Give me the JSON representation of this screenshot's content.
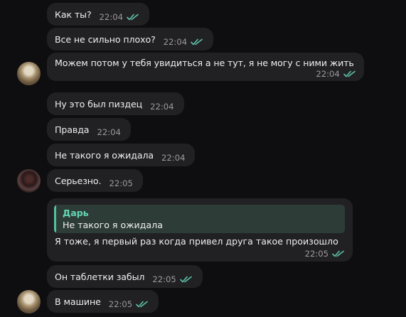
{
  "theme": {
    "bubble_color": "#212124",
    "background": "#0e0e10",
    "accent": "#4fc3a1",
    "read_check_color": "#5fc0a8"
  },
  "messages": [
    {
      "text": "Как ты?",
      "time": "22:04",
      "read": true,
      "avatar": false
    },
    {
      "text": "Все не сильно плохо?",
      "time": "22:04",
      "read": true,
      "avatar": false
    },
    {
      "text": "Можем потом у тебя увидиться а не тут, я не могу с ними жить",
      "time": "22:04",
      "read": true,
      "avatar": true
    },
    {
      "text": "Ну это был пиздец",
      "time": "22:04",
      "read": false,
      "avatar": false
    },
    {
      "text": "Правда",
      "time": "22:04",
      "read": false,
      "avatar": false
    },
    {
      "text": "Не такого я ожидала",
      "time": "22:04",
      "read": false,
      "avatar": false
    },
    {
      "text": "Серьезно.",
      "time": "22:05",
      "read": false,
      "avatar": true
    },
    {
      "reply_to": {
        "author": "Дарь",
        "text": "Не такого я ожидала"
      },
      "text": "Я тоже, я первый раз когда привел друга такое произошло",
      "time": "22:05",
      "read": true,
      "avatar": false
    },
    {
      "text": "Он таблетки забыл",
      "time": "22:05",
      "read": true,
      "avatar": false
    },
    {
      "text": "В машине",
      "time": "22:05",
      "read": true,
      "avatar": true
    }
  ]
}
